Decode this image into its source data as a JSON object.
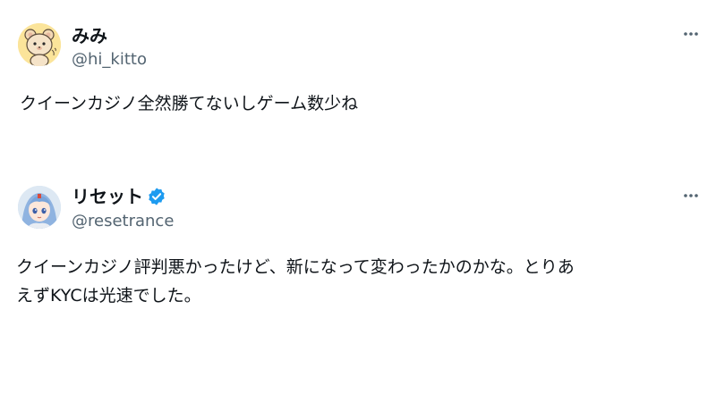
{
  "posts": [
    {
      "display_name": "みみ",
      "handle": "@hi_kitto",
      "text": "クイーンカジノ全然勝てないしゲーム数少ね",
      "verified": false,
      "avatar_icon": "bear-mascot-avatar"
    },
    {
      "display_name": "リセット",
      "handle": "@resetrance",
      "text": "クイーンカジノ評判悪かったけど、新になって変わったかのかな。とりあ\nえずKYCは光速でした。",
      "verified": true,
      "avatar_icon": "anime-girl-avatar"
    }
  ],
  "colors": {
    "handle": "#536471",
    "text": "#0f1419",
    "verified_badge": "#1d9bf0"
  }
}
